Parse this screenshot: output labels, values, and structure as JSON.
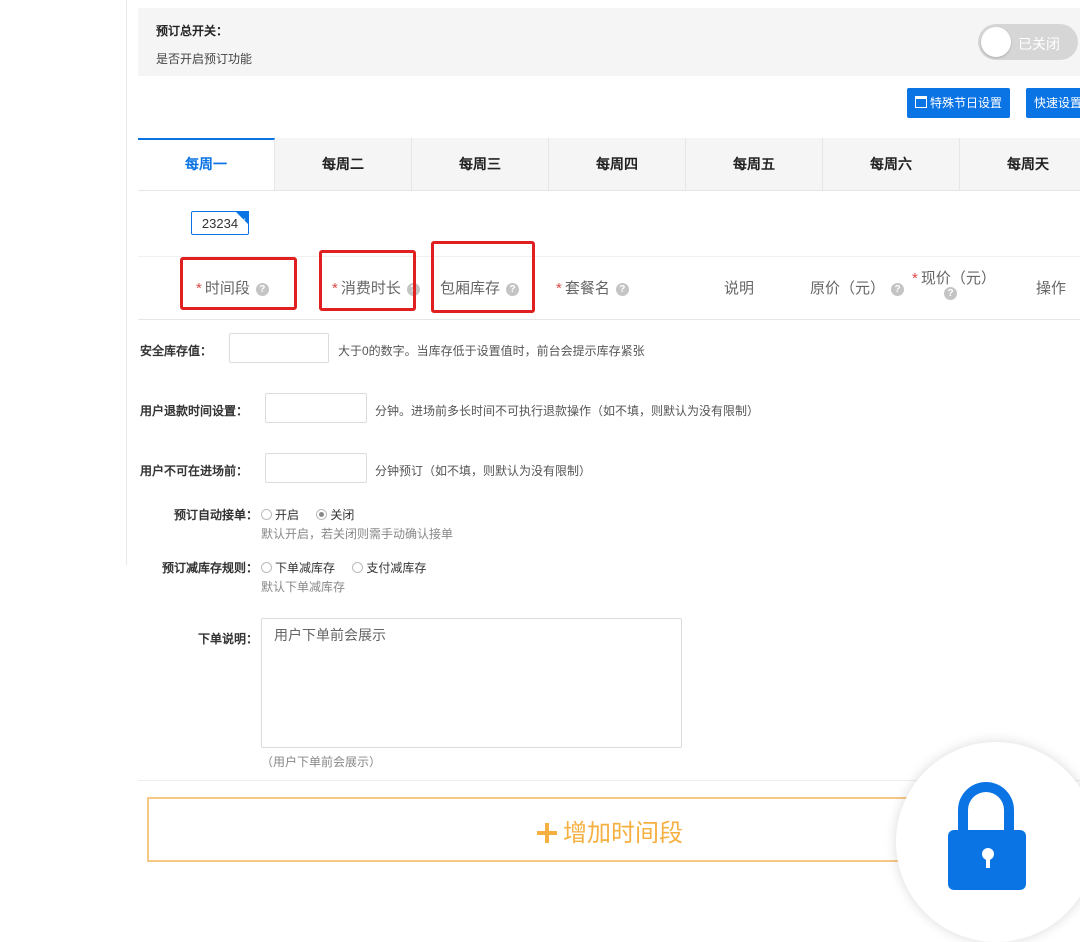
{
  "switch": {
    "title": "预订总开关：",
    "subtitle": "是否开启预订功能",
    "toggle_text": "已关闭"
  },
  "buttons": {
    "special": "特殊节日设置",
    "quick": "快速设置"
  },
  "tabs": [
    "每周一",
    "每周二",
    "每周三",
    "每周四",
    "每周五",
    "每周六",
    "每周天"
  ],
  "chip": "23234",
  "columns": {
    "time": "时间段",
    "duration": "消费时长",
    "stock": "包厢库存",
    "package": "套餐名",
    "desc": "说明",
    "orig": "原价（元）",
    "price": "现价（元）",
    "op": "操作"
  },
  "form": {
    "safety_label": "安全库存值：",
    "safety_hint": "大于0的数字。当库存低于设置值时，前台会提示库存紧张",
    "refund_label": "用户退款时间设置：",
    "refund_hint": "分钟。进场前多长时间不可执行退款操作（如不填，则默认为没有限制）",
    "noentry_label": "用户不可在进场前：",
    "noentry_hint": "分钟预订（如不填，则默认为没有限制）",
    "auto_label": "预订自动接单：",
    "auto_opt_on": "开启",
    "auto_opt_off": "关闭",
    "auto_hint": "默认开启，若关闭则需手动确认接单",
    "stock_rule_label": "预订减库存规则：",
    "stock_opt_order": "下单减库存",
    "stock_opt_pay": "支付减库存",
    "stock_rule_hint": "默认下单减库存",
    "note_label": "下单说明：",
    "note_placeholder": "用户下单前会展示",
    "note_hint": "（用户下单前会展示）"
  },
  "add_button": "增加时间段",
  "colors": {
    "accent": "#0b74e5",
    "warning": "#f5b041",
    "highlight": "#e02020"
  }
}
